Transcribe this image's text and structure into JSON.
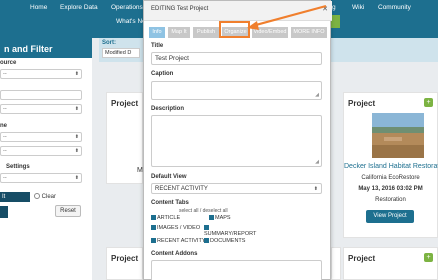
{
  "topnav": {
    "items": [
      "Home",
      "Explore Data",
      "Operations",
      "g",
      "Wiki",
      "Community"
    ],
    "whats_new": "What's New"
  },
  "filter": {
    "header": "n and Filter",
    "source_label": "ource",
    "source_value": "--",
    "field2_value": "--",
    "field3_label": "ne",
    "field3_value": "--",
    "field4_value": "--",
    "settings_label": "Settings",
    "settings_value": "--",
    "radio_label_1": "It",
    "radio_label_2": "Clear",
    "reset_label": "Reset"
  },
  "sort": {
    "label": "Sort:",
    "value": "Modified D"
  },
  "cards": {
    "left_top_title": "Project",
    "left_top_text": "M",
    "left_bottom_title": "Project",
    "right_bottom_title": "Project",
    "right_bottom2_title": "Project",
    "featured": {
      "title": "Project",
      "name": "Decker Island Habitat Restorati",
      "org": "California EcoRestore",
      "date": "May 13, 2016 03:02 PM",
      "type": "Restoration",
      "view_label": "View Project"
    }
  },
  "modal": {
    "title": "EDITING Test Project",
    "close": "✕",
    "tabs": [
      "Info",
      "Map It",
      "Publish",
      "Organize",
      "Video/Embed",
      "MORE INFO"
    ],
    "title_label": "Title",
    "title_value": "Test Project",
    "caption_label": "Caption",
    "description_label": "Description",
    "default_view_label": "Default View",
    "default_view_value": "RECENT ACTIVITY",
    "content_tabs_label": "Content Tabs",
    "select_all": "select all / deselect all",
    "checkboxes": [
      "ARTICLE",
      "MAPS",
      "IMAGES / VIDEO",
      "SUMMARY/REPORT",
      "RECENT ACTIVITY",
      "DOCUMENTS"
    ],
    "content_addons_label": "Content Addons"
  },
  "colors": {
    "brand": "#1d6f8f",
    "highlight": "#f07f2d",
    "active_tab": "#8fc3e3",
    "add_green": "#7cb342"
  }
}
